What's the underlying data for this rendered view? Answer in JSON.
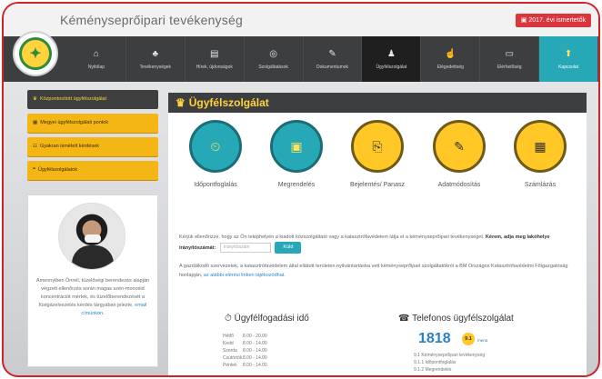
{
  "header": {
    "site_title": "Kéményseprőipari tevékenység",
    "badge": "2017. évi ismertetők"
  },
  "nav": {
    "items": [
      {
        "label": "Nyitólap",
        "icon": "home-icon",
        "glyph": "⌂"
      },
      {
        "label": "Tevékenységek",
        "icon": "sitemap-icon",
        "glyph": "♣"
      },
      {
        "label": "Hírek, újdonságok",
        "icon": "news-icon",
        "glyph": "▤"
      },
      {
        "label": "Szolgáltatások",
        "icon": "service-icon",
        "glyph": "◎"
      },
      {
        "label": "Dokumentumok",
        "icon": "document-icon",
        "glyph": "✎"
      },
      {
        "label": "Ügyfélszolgálat",
        "icon": "user-icon",
        "glyph": "♟"
      },
      {
        "label": "Elégedettség",
        "icon": "thumbs-up-icon",
        "glyph": "☝"
      },
      {
        "label": "Elérhetőség",
        "icon": "contact-icon",
        "glyph": "▭"
      },
      {
        "label": "Kapcsolat",
        "icon": "arrow-up-icon",
        "glyph": "⬆"
      }
    ]
  },
  "sidebar": {
    "items": [
      {
        "label": "Központosított ügyfélszolgálat",
        "glyph": "♛"
      },
      {
        "label": "Megyei ügyfélszolgálati pontok",
        "glyph": "▦"
      },
      {
        "label": "Gyakran ismételt kérdések",
        "glyph": "☷"
      },
      {
        "label": "Ügyfélszolgálatok",
        "glyph": "❝"
      }
    ],
    "card_text": "Amennyiben Önnél, tüzelőségi berendezés alapján végzett ellenőrzés során magas szén-monoxid koncentrációt mértek, és tüzelőberendezését a füstgázelvezetés kérdés tárgyában jelezte,",
    "card_link": "email címünkön."
  },
  "main": {
    "title": "Ügyfélszolgálat",
    "title_glyph": "♛",
    "circles": [
      {
        "label": "Időpontfoglalás",
        "glyph": "⏲",
        "icon": "clock-icon",
        "style": "teal"
      },
      {
        "label": "Megrendelés",
        "glyph": "▣",
        "icon": "calendar-icon",
        "style": "teal"
      },
      {
        "label": "Bejelentés/ Panasz",
        "glyph": "⎘",
        "icon": "copy-icon",
        "style": "yellow"
      },
      {
        "label": "Adatmódosítás",
        "glyph": "✎",
        "icon": "pencil-icon",
        "style": "yellow"
      },
      {
        "label": "Számlázás",
        "glyph": "▦",
        "icon": "calculator-icon",
        "style": "yellow"
      }
    ],
    "para1_pre": "Kérjük ellenőrizze, hogy az Ön telephelyén a kiadott közszolgáltató vagy a katasztrófavédelem látja el a kéményseprőipari tevékenységet.",
    "para1_bold": "Kérem, adja meg lakóhelye irányítószámát:",
    "zip_placeholder": "Irányítószám",
    "send_label": "Küld",
    "para2": "A gazdálkodó szervezetek, a katasztrófavédelem által ellátott területen nyilvántartásba vett kéményseprőipari szolgáltatókról a BM Országos Katasztrófavédelmi Főigazgatóság honlapján,",
    "para2_link": "az alábbi elérési linken tájékozódhat.",
    "hours_title": "Ügyfélfogadási idő",
    "hours_glyph": "⏱",
    "hours": [
      {
        "day": "Hétfő",
        "time": "8.00 - 20.00"
      },
      {
        "day": "Kedd",
        "time": "8.00 - 14.00"
      },
      {
        "day": "Szerda",
        "time": "8.00 - 14.00"
      },
      {
        "day": "Csütörtök",
        "time": "8.00 - 14.00"
      },
      {
        "day": "Péntek",
        "time": "8.00 - 14.00"
      }
    ],
    "phone_title": "Telefonos ügyfélszolgálat",
    "phone_glyph": "☎",
    "phone_number": "1818",
    "phone_badge": "9.1",
    "phone_sub": "menü",
    "phone_list": [
      "9.1 Kéményseprőipari tevékenység",
      "9.1.1 Időpontfoglalás",
      "9.1.2 Megrendelés"
    ]
  }
}
